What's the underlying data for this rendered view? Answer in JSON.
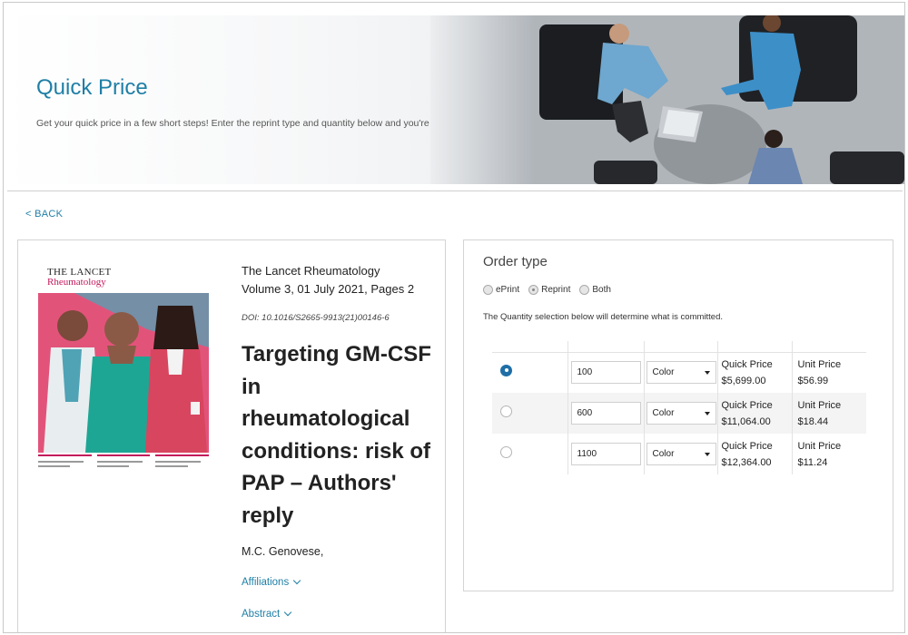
{
  "hero": {
    "title": "Quick Price",
    "subtitle": "Get your quick price in a few short steps! Enter the reprint type and quantity below and you're all set."
  },
  "nav": {
    "back_label": "< BACK"
  },
  "article": {
    "cover": {
      "brand": "THE LANCET",
      "journal_sub": "Rheumatology"
    },
    "journal": "The Lancet Rheumatology",
    "volume_line": "Volume 3, 01 July 2021, Pages 2",
    "doi": "DOI: 10.1016/S2665-9913(21)00146-6",
    "title": "Targeting GM-CSF in rheumatological conditions: risk of PAP – Authors' reply",
    "authors": "M.C. Genovese,",
    "affiliations_label": "Affiliations",
    "abstract_label": "Abstract"
  },
  "order": {
    "title": "Order type",
    "types": [
      {
        "label": "ePrint",
        "selected": false
      },
      {
        "label": "Reprint",
        "selected": true
      },
      {
        "label": "Both",
        "selected": false
      }
    ],
    "note": "The Quantity selection below will determine what is committed.",
    "rows": [
      {
        "selected": true,
        "quantity": "100",
        "color": "Color",
        "quick_price_label": "Quick Price",
        "quick_price": "$5,699.00",
        "unit_price_label": "Unit Price",
        "unit_price": "$56.99"
      },
      {
        "selected": false,
        "quantity": "600",
        "color": "Color",
        "quick_price_label": "Quick Price",
        "quick_price": "$11,064.00",
        "unit_price_label": "Unit Price",
        "unit_price": "$18.44"
      },
      {
        "selected": false,
        "quantity": "1100",
        "color": "Color",
        "quick_price_label": "Quick Price",
        "quick_price": "$12,364.00",
        "unit_price_label": "Unit Price",
        "unit_price": "$11.24"
      }
    ]
  },
  "colors": {
    "accent": "#1f7fa6",
    "brand_pink": "#c2185b",
    "radio_selected": "#1f6fa6"
  }
}
